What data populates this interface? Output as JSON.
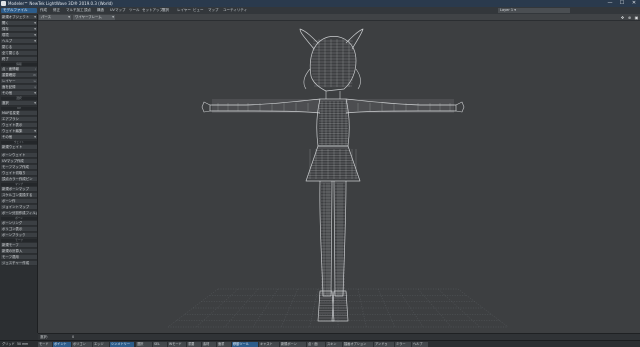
{
  "window": {
    "title": "Modeler™ NewTek LightWave 3D® 2019.0.3 (World)",
    "minimize": "—",
    "maximize": "☐",
    "close": "✕"
  },
  "menubar": {
    "main_tab": "モデルファイル",
    "menu_items": [
      "作成",
      "修正",
      "マルチ加工",
      "頂点",
      "構造",
      "UVマップ",
      "ツール",
      "セットアップ",
      "選択",
      "レイヤー",
      "ビュー",
      "マップ",
      "ユーティリティ"
    ],
    "layer_dropdown": "Layer 1 ▾"
  },
  "left_panel": {
    "top_groups": [
      {
        "header": "",
        "items": [
          {
            "label": "新規オブジェクト",
            "dropdown": true
          },
          {
            "label": "開く",
            "dropdown": true
          },
          {
            "label": "保存",
            "dropdown": true
          },
          {
            "label": "環境",
            "dropdown": true
          },
          {
            "label": "ヘルプ",
            "dropdown": true
          },
          {
            "label": "閉じる",
            "dropdown": false
          },
          {
            "label": "全て閉じる",
            "dropdown": false
          },
          {
            "label": "終了",
            "dropdown": false
          }
        ]
      },
      {
        "header": "情報",
        "items": [
          {
            "label": "点・面情報",
            "sub": "i"
          },
          {
            "label": "重要確認",
            "sub": "W"
          },
          {
            "label": "レイヤー",
            "sub": "w"
          },
          {
            "label": "面を記録",
            "sub": "q"
          },
          {
            "label": "その他",
            "sub": "",
            "dropdown": true
          }
        ]
      },
      {
        "header": "選択",
        "items": [
          {
            "label": "選択",
            "dropdown": true
          }
        ]
      },
      {
        "header": "UV",
        "items": [
          {
            "label": "MAP名変更",
            "sub": ""
          },
          {
            "label": "エアブラシ",
            "sub": ""
          },
          {
            "label": "ウェイト表示",
            "sub": ""
          },
          {
            "label": "ウェイト編集",
            "dropdown": true
          },
          {
            "label": "その他",
            "dropdown": true
          }
        ]
      },
      {
        "header": "ウェイト",
        "items": [
          {
            "label": "新規ウェイト",
            "sub": ""
          }
        ]
      },
      {
        "header": "",
        "items": [
          {
            "label": "ボーンウェイト",
            "sub": ""
          },
          {
            "label": "UVマップ作成",
            "sub": ""
          },
          {
            "label": "モーフマップ作成",
            "sub": ""
          },
          {
            "label": "ウェイト切取り",
            "sub": ""
          },
          {
            "label": "頂点カラー作成ピン",
            "sub": ""
          }
        ]
      },
      {
        "header": "マップ",
        "items": [
          {
            "label": "新規ボーンマップ",
            "sub": ""
          },
          {
            "label": "スケルゴン変換する",
            "sub": ""
          },
          {
            "label": "ボーン作",
            "sub": ""
          },
          {
            "label": "ジョイントマップ",
            "sub": ""
          },
          {
            "label": "ボーン分割作成フィルム",
            "sub": ""
          }
        ]
      },
      {
        "header": "ボーン",
        "items": [
          {
            "label": "ボーンリング",
            "sub": ""
          },
          {
            "label": "ポリゴン表示",
            "sub": ""
          },
          {
            "label": "ボーンブラック",
            "sub": ""
          }
        ]
      },
      {
        "header": "モーフ",
        "items": [
          {
            "label": "新規モーフ",
            "sub": ""
          },
          {
            "label": "新規の計算入",
            "sub": ""
          },
          {
            "label": "モーフ適用",
            "sub": ""
          },
          {
            "label": "ジェスチャー作成",
            "sub": ""
          }
        ]
      }
    ]
  },
  "viewport": {
    "view_dropdown": "パース",
    "render_dropdown": "ワイヤーフレーム",
    "icons": [
      "move-icon",
      "zoom-icon",
      "maximize-icon"
    ],
    "mesh_color": "#d9dcde",
    "grid_color": "#5a5e62"
  },
  "infobar": {
    "label": "選択:",
    "value": "0"
  },
  "bottombar": {
    "items": [
      {
        "label": "グリッド:",
        "style": "plain"
      },
      {
        "label": "50 mm",
        "style": "plain"
      },
      {
        "label": "モード",
        "style": "dd"
      },
      {
        "label": "ポイント",
        "style": "active"
      },
      {
        "label": "ポリゴン",
        "style": "dd"
      },
      {
        "label": "エッジ",
        "style": "dd"
      },
      {
        "label": "シンメトリー",
        "style": "active"
      },
      {
        "label": "選択",
        "style": "dd"
      },
      {
        "label": "SEL",
        "style": "dd"
      },
      {
        "label": "Wモード",
        "style": "dd"
      },
      {
        "label": "重要",
        "style": "dd"
      },
      {
        "label": "素材",
        "style": "dd"
      },
      {
        "label": "面重",
        "style": "dd"
      },
      {
        "label": "移動ツール",
        "style": "active"
      },
      {
        "label": "キャスト",
        "style": "dd"
      },
      {
        "label": "新規ボーン",
        "style": "dd"
      },
      {
        "label": "点・面",
        "style": "dd"
      },
      {
        "label": "スキン",
        "style": "dd"
      },
      {
        "label": "描画オプション",
        "style": "dd"
      },
      {
        "label": "アンドゥ",
        "style": "dd"
      },
      {
        "label": "ミラー",
        "style": "dd"
      },
      {
        "label": "ヘルプ",
        "style": "dd"
      }
    ]
  }
}
